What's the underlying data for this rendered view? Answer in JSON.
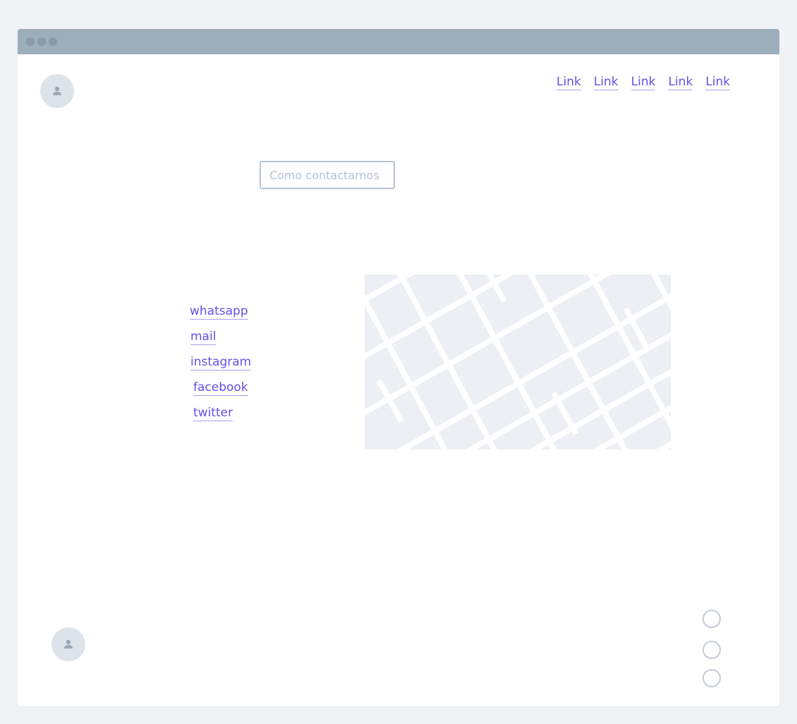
{
  "nav": {
    "links": [
      "Link",
      "Link",
      "Link",
      "Link",
      "Link"
    ]
  },
  "contact": {
    "placeholder": "Como contactarnos",
    "value": ""
  },
  "social": {
    "links": [
      "whatsapp",
      "mail",
      "instagram",
      "facebook",
      "twitter"
    ]
  },
  "icons": {
    "header_avatar": "user-icon",
    "footer_avatar": "user-icon",
    "map": "map-placeholder"
  },
  "colors": {
    "link": "#6152e6",
    "titlebar": "#9daebb",
    "avatar_bg": "#dde3ea",
    "map_bg": "#eceff4"
  },
  "footer": {
    "radio_options": 3
  }
}
